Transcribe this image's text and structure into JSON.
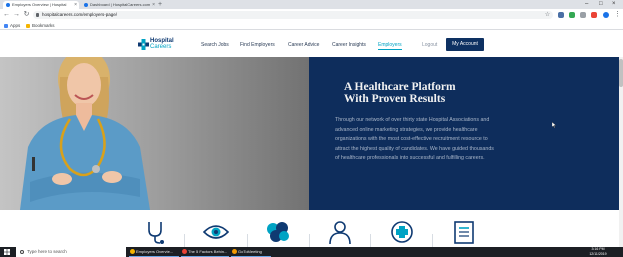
{
  "browser": {
    "tabs": [
      {
        "title": "Employers Overview | Hospital"
      },
      {
        "title": "Dashboard | HospitalCareers.com"
      }
    ],
    "url": "hospitalcareers.com/employers-page/",
    "bookmarks": [
      "Apps",
      "Bookmarks"
    ]
  },
  "site": {
    "logo": {
      "line1": "Hospital",
      "line2": "Careers"
    },
    "menu": [
      "Search Jobs",
      "Find Employers",
      "Career Advice",
      "Career Insights",
      "Employers"
    ],
    "active_menu": "Employers",
    "logout": "Logout",
    "account_button": "My Account"
  },
  "hero": {
    "title_line1": "A Healthcare Platform",
    "title_line2": "With Proven Results",
    "body": "Through our network of over thirty state Hospital Associations and advanced online marketing strategies, we provide healthcare organizations with the most cost-effective recruitment resource to attract the highest quality of candidates. We have guided thousands of healthcare professionals into successful and fulfilling careers."
  },
  "features": {
    "icons": [
      "stethoscope-icon",
      "eye-icon",
      "brain-icon",
      "person-icon",
      "medical-cross-icon",
      "document-icon"
    ]
  },
  "taskbar": {
    "search_placeholder": "Type here to search",
    "apps": [
      {
        "label": "Employers Overvie..."
      },
      {
        "label": "The 5 Factors Behin..."
      },
      {
        "label": "GoToMeeting"
      }
    ],
    "time": "3:16 PM",
    "date": "12/11/2019"
  },
  "colors": {
    "navy": "#0e2d5c",
    "teal": "#00a3c4",
    "button": "#0e3162"
  }
}
